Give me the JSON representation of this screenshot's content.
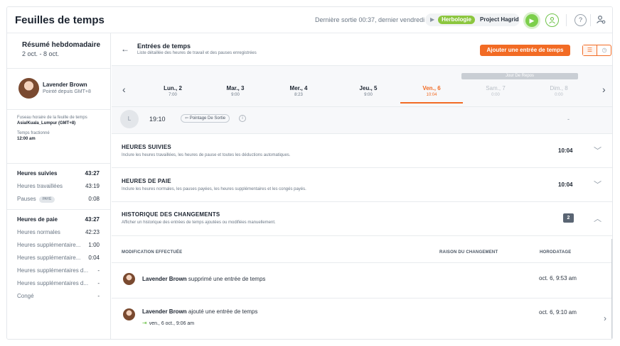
{
  "header": {
    "title": "Feuilles de temps",
    "last_out": "Dernière sortie 00:37, dernier vendredi",
    "timer": {
      "play_small": "▶",
      "tag": "Herbologie",
      "project": "Project Hagrid"
    },
    "help_icon_char": "?"
  },
  "sidebar": {
    "week_title": "Résumé hebdomadaire",
    "week_range": "2 oct. - 8 oct.",
    "user": {
      "name": "Lavender Brown",
      "sub": "Pointé depuis GMT+8"
    },
    "timezone_label": "Fuseau horaire de la feuille de temps",
    "timezone_value": "Asia/Kuala_Lumpur (GMT+8)",
    "split_label": "Temps fractionné",
    "split_value": "12:00 am",
    "tracked": [
      {
        "label": "Heures suivies",
        "value": "43:27",
        "bold": true
      },
      {
        "label": "Heures travaillées",
        "value": "43:19"
      },
      {
        "label": "Pauses",
        "value": "0:08",
        "badge": "PAYÉ"
      }
    ],
    "payroll": [
      {
        "label": "Heures de paie",
        "value": "43:27",
        "bold": true
      },
      {
        "label": "Heures normales",
        "value": "42:23"
      },
      {
        "label": "Heures supplémentaire...",
        "value": "1:00"
      },
      {
        "label": "Heures supplémentaire...",
        "value": "0:04"
      },
      {
        "label": "Heures supplémentaires d...",
        "value": "-"
      },
      {
        "label": "Heures supplémentaires d...",
        "value": "-"
      },
      {
        "label": "Congé",
        "value": "-"
      }
    ]
  },
  "entries": {
    "title": "Entrées de temps",
    "subtitle": "Liste détaillée des heures de travail et des pauses enregistrées",
    "add_button": "Ajouter une entrée de temps",
    "rest_label": "Jour De Repos",
    "days": [
      {
        "name": "Lun., 2",
        "hours": "7:00",
        "state": "normal"
      },
      {
        "name": "Mar., 3",
        "hours": "9:00",
        "state": "normal"
      },
      {
        "name": "Mer., 4",
        "hours": "8:23",
        "state": "normal"
      },
      {
        "name": "Jeu., 5",
        "hours": "9:00",
        "state": "normal"
      },
      {
        "name": "Ven., 6",
        "hours": "10:04",
        "state": "active"
      },
      {
        "name": "Sam., 7",
        "hours": "0:00",
        "state": "muted"
      },
      {
        "name": "Dim., 8",
        "hours": "0:00",
        "state": "muted"
      }
    ],
    "entry": {
      "initial": "L",
      "time": "19:10",
      "type": "Pointage De Sortie",
      "info": "i",
      "value": "-"
    }
  },
  "sections": {
    "tracked": {
      "title": "HEURES SUIVIES",
      "subtitle": "Inclure les heures travaillées, les heures de pause et toutes les déductions automatiques.",
      "value": "10:04"
    },
    "pay": {
      "title": "HEURES DE PAIE",
      "subtitle": "Inclure les heures normales, les pauses payées, les heures supplémentaires et les congés payés.",
      "value": "10:04"
    },
    "history": {
      "title": "HISTORIQUE DES CHANGEMENTS",
      "subtitle": "Afficher un historique des entrées de temps ajoutées ou modifiées manuellement.",
      "count": "2"
    }
  },
  "history": {
    "columns": {
      "change": "MODIFICATION EFFECTUÉE",
      "reason": "RAISON DU CHANGEMENT",
      "timestamp": "HORODATAGE"
    },
    "rows": [
      {
        "user": "Lavender Brown",
        "action": " supprimé une entrée de temps",
        "timestamp": "oct. 6, 9:53 am"
      },
      {
        "user": "Lavender Brown",
        "action": " ajouté une entrée de temps",
        "timestamp": "oct. 6, 9:10 am",
        "detail": "ven., 6 oct., 9:06 am"
      }
    ]
  },
  "icons": {
    "back": "arrow-left-icon",
    "play": "play-icon",
    "user": "user-circle-icon",
    "help": "help-icon",
    "settings": "user-settings-icon",
    "list_view": "list-view-icon",
    "clock_view": "clock-view-icon",
    "chevron_left": "chevron-left-icon",
    "chevron_right": "chevron-right-icon",
    "chevron_down": "chevron-down-icon",
    "chevron_up": "chevron-up-icon",
    "enter": "enter-icon"
  },
  "colors": {
    "accent": "#f26b24",
    "green": "#7ccf4b",
    "tag_green": "#8cc63f",
    "rest_gray": "#c9ced4"
  }
}
